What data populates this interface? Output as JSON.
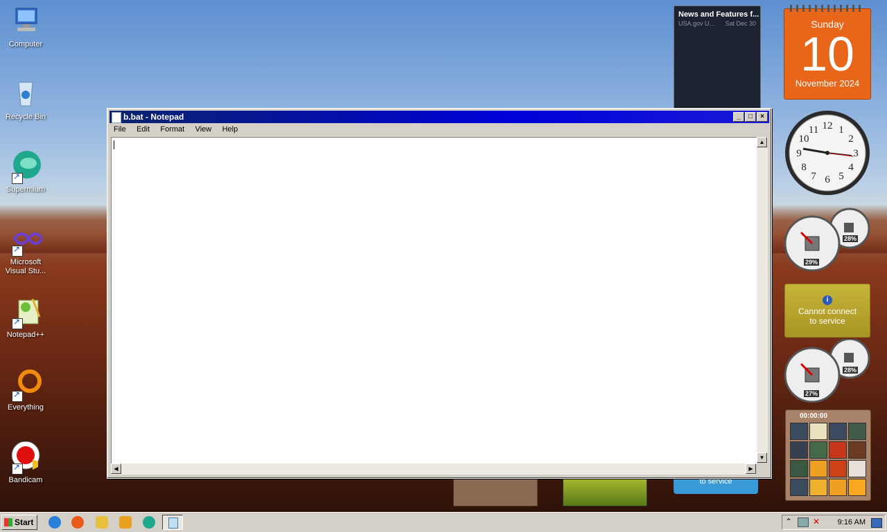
{
  "desktop_icons": [
    {
      "label": "Computer",
      "icon": "computer-icon"
    },
    {
      "label": "Recycle Bin",
      "icon": "recycle-bin-icon"
    },
    {
      "label": "Supermium",
      "icon": "supermium-icon"
    },
    {
      "label": "Microsoft Visual Stu...",
      "icon": "visual-studio-icon"
    },
    {
      "label": "Notepad++",
      "icon": "notepadpp-icon"
    },
    {
      "label": "Everything",
      "icon": "everything-icon"
    },
    {
      "label": "Bandicam",
      "icon": "bandicam-icon"
    }
  ],
  "window": {
    "title": "b.bat - Notepad",
    "menu": [
      "File",
      "Edit",
      "Format",
      "View",
      "Help"
    ],
    "content": ""
  },
  "gadgets": {
    "news": {
      "title": "News and Features f...",
      "source": "USA.gov U...",
      "date": "Sat Dec 30"
    },
    "calendar": {
      "day_name": "Sunday",
      "day": "10",
      "month_year": "November 2024"
    },
    "meter1": {
      "cpu": "29%",
      "mem": "28%"
    },
    "weather": {
      "message": "Cannot connect to service",
      "partial_message": "to service"
    },
    "meter2": {
      "cpu": "27%",
      "mem": "28%"
    },
    "puzzle": {
      "timer": "00:00:00"
    }
  },
  "taskbar": {
    "start_label": "Start",
    "time": "9:16 AM"
  },
  "colors": {
    "title_bar": "#0a246a",
    "calendar": "#e8661a",
    "weather": "#b8a42a"
  }
}
